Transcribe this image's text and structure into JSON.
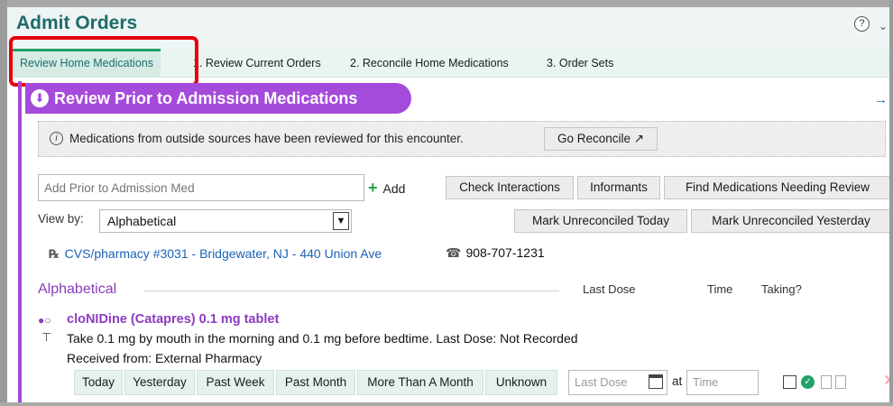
{
  "header": {
    "title": "Admit Orders",
    "help_icon": "?",
    "corner_icon": "⌄"
  },
  "tabs": [
    {
      "label": "Review Home Medications",
      "active": true
    },
    {
      "label": "1. Review Current Orders"
    },
    {
      "label": "2. Reconcile Home Medications"
    },
    {
      "label": "3. Order Sets"
    }
  ],
  "section": {
    "title": "Review Prior to Admission Medications",
    "arrow": "→"
  },
  "banner": {
    "text": "Medications from outside sources have been reviewed for this encounter.",
    "go_reconcile": "Go Reconcile ↗"
  },
  "toolbar": {
    "add_placeholder": "Add Prior to Admission Med",
    "add_label": "Add",
    "check_interactions": "Check Interactions",
    "informants": "Informants",
    "find_meds": "Find Medications Needing Review",
    "view_by_label": "View by:",
    "view_by_value": "Alphabetical",
    "mark_today": "Mark Unreconciled Today",
    "mark_yesterday": "Mark Unreconciled Yesterday"
  },
  "pharmacy": {
    "rx_icon": "℞",
    "name": "CVS/pharmacy #3031 - Bridgewater, NJ - 440 Union Ave",
    "phone": "908-707-1231"
  },
  "list": {
    "heading": "Alphabetical",
    "columns": {
      "last_dose": "Last Dose",
      "time": "Time",
      "taking": "Taking?"
    }
  },
  "medication": {
    "name": "cloNIDine (Catapres) 0.1 mg tablet",
    "sig": "Take 0.1 mg by mouth in the morning and 0.1 mg before bedtime. Last Dose: Not Recorded",
    "received": "Received from: External Pharmacy",
    "dose_buttons": [
      "Today",
      "Yesterday",
      "Past Week",
      "Past Month",
      "More Than A Month",
      "Unknown"
    ],
    "last_dose_placeholder": "Last Dose",
    "at": "at",
    "time_placeholder": "Time"
  },
  "colors": {
    "accent_purple": "#a54bdb",
    "title_teal": "#1f6b6b",
    "link_blue": "#1b62b6",
    "highlight_red": "#e8000c"
  }
}
